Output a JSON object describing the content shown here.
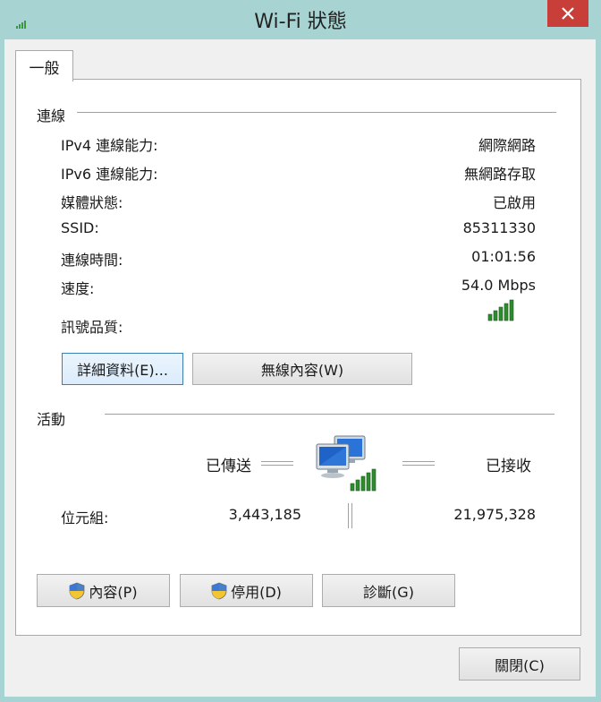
{
  "window": {
    "title": "Wi-Fi 狀態",
    "close_label": "✕"
  },
  "tabs": [
    {
      "label": "一般"
    }
  ],
  "connection": {
    "section_title": "連線",
    "rows": [
      {
        "label": "IPv4 連線能力:",
        "value": "網際網路"
      },
      {
        "label": "IPv6 連線能力:",
        "value": "無網路存取"
      },
      {
        "label": "媒體狀態:",
        "value": "已啟用"
      },
      {
        "label": "SSID:",
        "value": "85311330"
      },
      {
        "label": "連線時間:",
        "value": "01:01:56"
      },
      {
        "label": "速度:",
        "value": "54.0 Mbps"
      }
    ],
    "signal_label": "訊號品質:",
    "signal_bars": 5,
    "details_button": "詳細資料(E)...",
    "wireless_props_button": "無線內容(W)"
  },
  "activity": {
    "section_title": "活動",
    "sent_label": "已傳送",
    "received_label": "已接收",
    "bytes_label": "位元組:",
    "bytes_sent": "3,443,185",
    "bytes_received": "21,975,328"
  },
  "buttons": {
    "properties": "內容(P)",
    "disable": "停用(D)",
    "diagnose": "診斷(G)",
    "close": "關閉(C)"
  },
  "colors": {
    "signal_green": "#2e8b2e",
    "close_red": "#c73f38",
    "window_frame": "#a7d3d2"
  }
}
